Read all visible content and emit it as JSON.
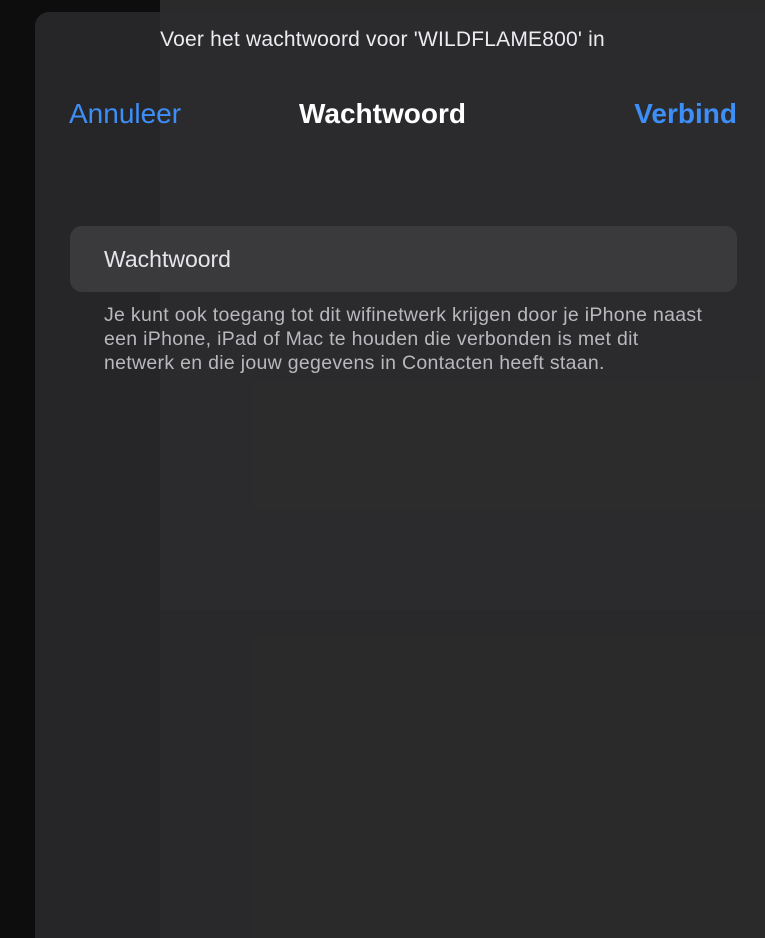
{
  "prompt": "Voer het wachtwoord voor 'WILDFLAME800' in",
  "nav": {
    "cancel_label": "Annuleer",
    "title": "Wachtwoord",
    "connect_label": "Verbind"
  },
  "password_field": {
    "placeholder": "Wachtwoord",
    "value": ""
  },
  "footnote": "Je kunt ook toegang tot dit wifinetwerk krijgen door je iPhone naast een iPhone, iPad of Mac te houden die verbonden is met dit netwerk en die jouw gegevens in Contacten heeft staan.",
  "colors": {
    "accent": "#3d8ef7",
    "sheet_background": "#2c2c2e",
    "field_background": "#3a3a3c"
  }
}
